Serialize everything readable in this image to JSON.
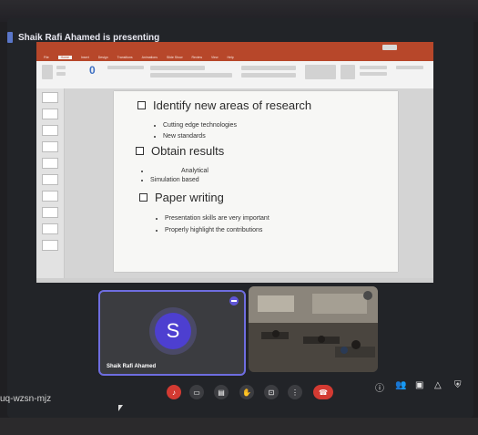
{
  "presenter_banner": "Shaik Rafi Ahamed is presenting",
  "powerpoint": {
    "tabs": [
      "File",
      "Home",
      "Insert",
      "Design",
      "Transitions",
      "Animations",
      "Slide Show",
      "Review",
      "View",
      "Help"
    ],
    "selected_tab": "Home"
  },
  "slide": {
    "sections": [
      {
        "heading": "Identify new areas of research",
        "bullets": [
          "Cutting edge technologies",
          "New standards"
        ]
      },
      {
        "heading": "Obtain results",
        "bullets": [
          "Analytical",
          "Simulation based"
        ]
      },
      {
        "heading": "Paper writing",
        "bullets": [
          "Presentation skills are very important",
          "Properly highlight the contributions"
        ]
      }
    ]
  },
  "participant": {
    "initial": "S",
    "name": "Shaik Rafi Ahamed"
  },
  "meeting_code": "uq-wzsn-mjz",
  "controls": [
    "mic",
    "camera",
    "captions",
    "raise-hand",
    "present",
    "more",
    "end-call"
  ],
  "side_controls": [
    "info",
    "people",
    "chat",
    "activities",
    "host-controls"
  ]
}
